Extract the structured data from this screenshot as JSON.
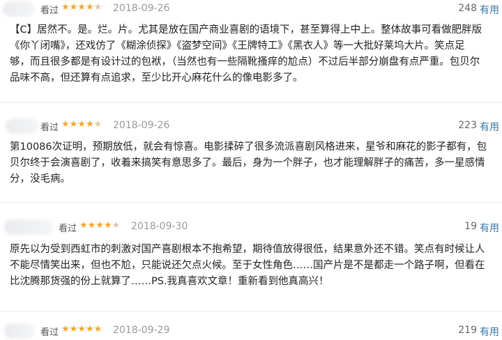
{
  "reviews": [
    {
      "seen": "看过",
      "rating": 4,
      "date": "2018-09-26",
      "votes": "248",
      "useful_label": "有用",
      "lines": [
        "【C】居然不。是。烂。片。尤其是放在国产商业喜剧的语境下，甚至算得上中上。整体故事可看做肥胖版",
        "《你丫闭嘴》，还戏仿了《糊涂侦探》《盗梦空间》《王牌特工》《黑衣人》等一大批好莱坞大片。笑点足",
        "够，而且很多都是有设计过的包袱，（当然也有一些隔靴搔痒的尬点）不过后半部分崩盘有点严重。包贝尔",
        "品味不高，但还算有点追求，至少比开心麻花什么的像电影多了。"
      ]
    },
    {
      "seen": "看过",
      "rating": 4,
      "date": "2018-09-26",
      "votes": "223",
      "useful_label": "有用",
      "lines": [
        "第10086次证明，预期放低，就会有惊喜。电影揉碎了很多流派喜剧风格进来，星爷和麻花的影子都有，包",
        "贝尔终于会演喜剧了，收着来搞笑有意思多了。最后，身为一个胖子，也才能理解胖子的痛苦，多一星感情",
        "分，没毛病。"
      ]
    },
    {
      "seen": "看过",
      "rating": 4,
      "date": "2018-09-30",
      "votes": "19",
      "useful_label": "有用",
      "lines": [
        "原先以为受到西虹市的刺激对国产喜剧根本不抱希望，期待值放得很低，结果意外还不错。笑点有时候让人",
        "不能尽情笑出来，但也不尬，只能说还欠点火候。至于女性角色……国产片是不是都走一个路子啊，但看在",
        "比沈腾那货强的份上就算了……PS.我真喜欢文章！重新看到他真高兴！"
      ]
    },
    {
      "seen": "看过",
      "rating": 5,
      "date": "2018-09-29",
      "votes": "219",
      "useful_label": "有用",
      "lines": []
    }
  ]
}
